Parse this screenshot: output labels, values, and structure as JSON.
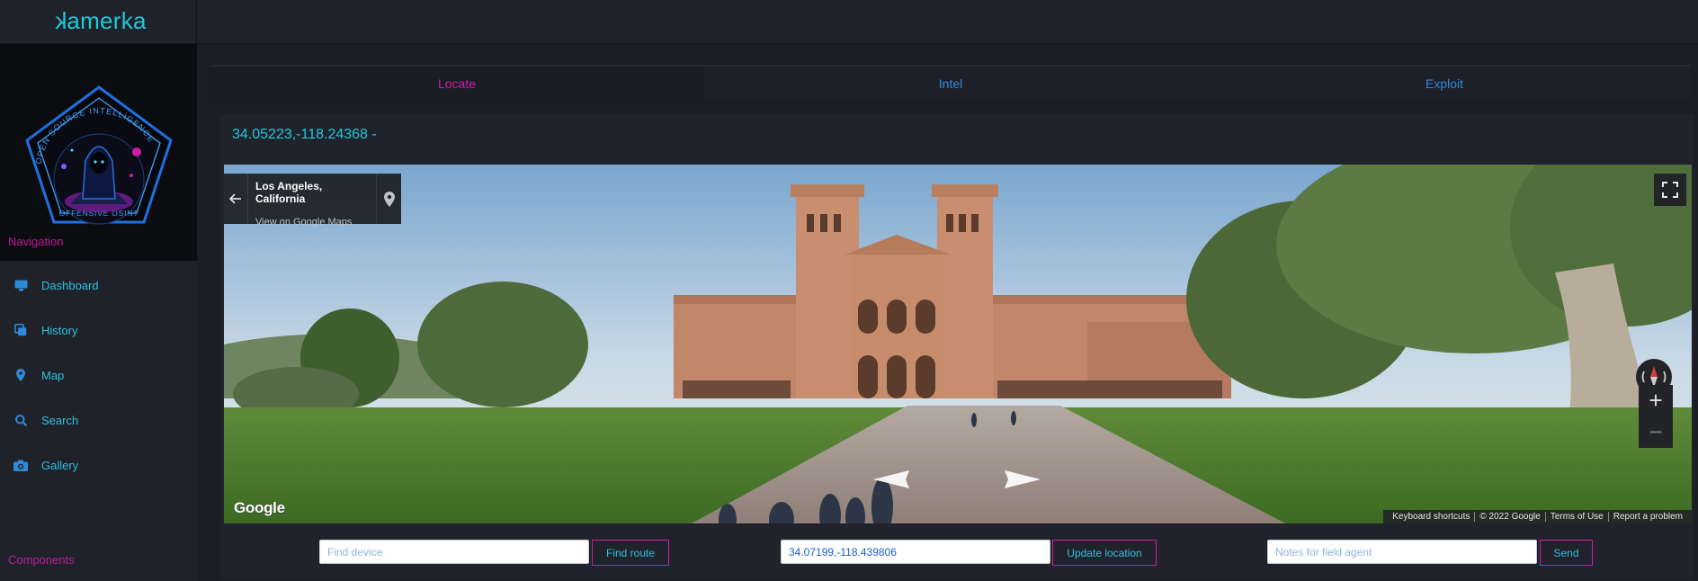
{
  "app": {
    "title": "kamerka"
  },
  "logo": {
    "ring_top": "OPEN SOURCE   INTELLIGENCE",
    "ring_bottom": "OFFENSIVE OSINT"
  },
  "sidebar": {
    "nav_heading": "Navigation",
    "items": [
      {
        "label": "Dashboard",
        "icon": "monitor-icon"
      },
      {
        "label": "History",
        "icon": "copy-icon"
      },
      {
        "label": "Map",
        "icon": "map-pin-icon"
      },
      {
        "label": "Search",
        "icon": "search-icon"
      },
      {
        "label": "Gallery",
        "icon": "camera-icon"
      }
    ],
    "components_heading": "Components"
  },
  "tabs": [
    {
      "label": "Locate",
      "active": true
    },
    {
      "label": "Intel",
      "active": false
    },
    {
      "label": "Exploit",
      "active": false
    }
  ],
  "locate": {
    "coords_title": "34.05223,-118.24368 -",
    "streetview": {
      "place_name": "Los Angeles, California",
      "maps_link": "View on Google Maps",
      "google_logo": "Google",
      "attribution": [
        "Keyboard shortcuts",
        "© 2022 Google",
        "Terms of Use",
        "Report a problem"
      ]
    },
    "find_device": {
      "placeholder": "Find device",
      "value": "",
      "button": "Find route"
    },
    "update_location": {
      "value": "34.07199,-118.439806",
      "button": "Update location"
    },
    "notes": {
      "placeholder": "Notes for field agent",
      "value": "",
      "button": "Send"
    }
  },
  "colors": {
    "accent_cyan": "#22c7d8",
    "accent_magenta": "#d21aa6",
    "link_blue": "#2f89d9",
    "bg": "#1b1e25"
  }
}
